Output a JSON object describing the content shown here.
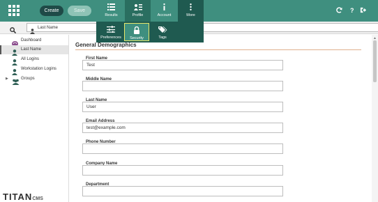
{
  "toolbar": {
    "create_label": "Create",
    "save_label": "Save"
  },
  "nav": {
    "tabs": [
      {
        "label": "Results",
        "icon": "results-list-icon"
      },
      {
        "label": "Profile",
        "icon": "profile-card-icon"
      },
      {
        "label": "Account",
        "icon": "info-icon"
      },
      {
        "label": "More",
        "icon": "more-vertical-icon"
      }
    ],
    "right_icons": [
      "refresh-icon",
      "help-icon",
      "logout-icon"
    ],
    "help_glyph": "?"
  },
  "search": {
    "field_value": "Last Name"
  },
  "profile_menu": {
    "items": [
      {
        "label": "Preferences",
        "icon": "sliders-icon"
      },
      {
        "label": "Security",
        "icon": "lock-icon"
      },
      {
        "label": "Tags",
        "icon": "tags-icon"
      }
    ]
  },
  "sidebar": {
    "items": [
      {
        "label": "Dashboard",
        "icon": "palette-icon"
      },
      {
        "label": "Last Name",
        "icon": "user-icon"
      },
      {
        "label": "All Logins",
        "icon": "user-icon"
      },
      {
        "label": "Workstation Logins",
        "icon": "user-icon"
      },
      {
        "label": "Groups",
        "icon": "users-icon"
      }
    ],
    "groups_caret": "▶"
  },
  "logo": {
    "brand": "TITAN",
    "suffix": "CMS"
  },
  "form": {
    "title": "General Demographics",
    "fields": [
      {
        "label": "First Name",
        "value": "Test"
      },
      {
        "label": "Middle Name",
        "value": ""
      },
      {
        "label": "Last Name",
        "value": "User"
      },
      {
        "label": "Email Address",
        "value": "test@example.com"
      },
      {
        "label": "Phone Number",
        "value": ""
      },
      {
        "label": "Company Name",
        "value": ""
      },
      {
        "label": "Department",
        "value": ""
      }
    ]
  },
  "colors": {
    "header": "#3f8f7f",
    "header_dark": "#1f5a50",
    "title_rule": "#e0b08c"
  }
}
